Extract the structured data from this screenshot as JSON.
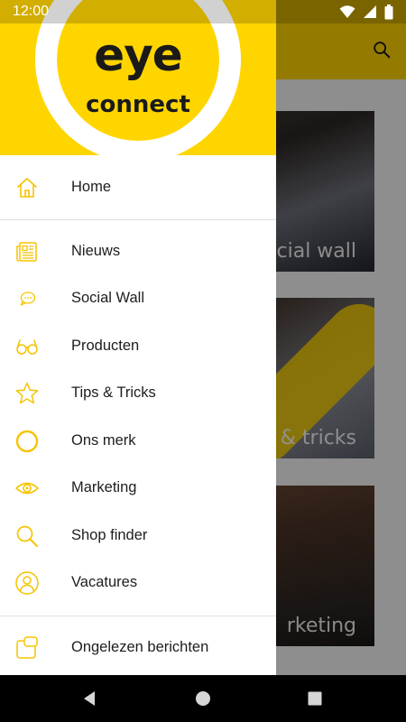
{
  "status_bar": {
    "time": "12:00"
  },
  "drawer": {
    "logo": {
      "line1": "eye",
      "line2": "connect"
    },
    "items": [
      {
        "label": "Home",
        "icon": "home-icon"
      },
      {
        "label": "Nieuws",
        "icon": "newspaper-icon"
      },
      {
        "label": "Social Wall",
        "icon": "chat-bubble-icon"
      },
      {
        "label": "Producten",
        "icon": "glasses-icon"
      },
      {
        "label": "Tips & Tricks",
        "icon": "star-icon"
      },
      {
        "label": "Ons merk",
        "icon": "circle-icon"
      },
      {
        "label": "Marketing",
        "icon": "eye-icon"
      },
      {
        "label": "Shop finder",
        "icon": "search-icon"
      },
      {
        "label": "Vacatures",
        "icon": "user-icon"
      },
      {
        "label": "Ongelezen berichten",
        "icon": "unread-messages-icon"
      }
    ]
  },
  "background": {
    "cards": [
      {
        "caption": "cial wall"
      },
      {
        "caption": "& tricks"
      },
      {
        "caption": "rketing"
      }
    ]
  },
  "colors": {
    "brand_yellow": "#ffd500",
    "icon_yellow": "#f5c400",
    "text": "#1d1d1d"
  }
}
